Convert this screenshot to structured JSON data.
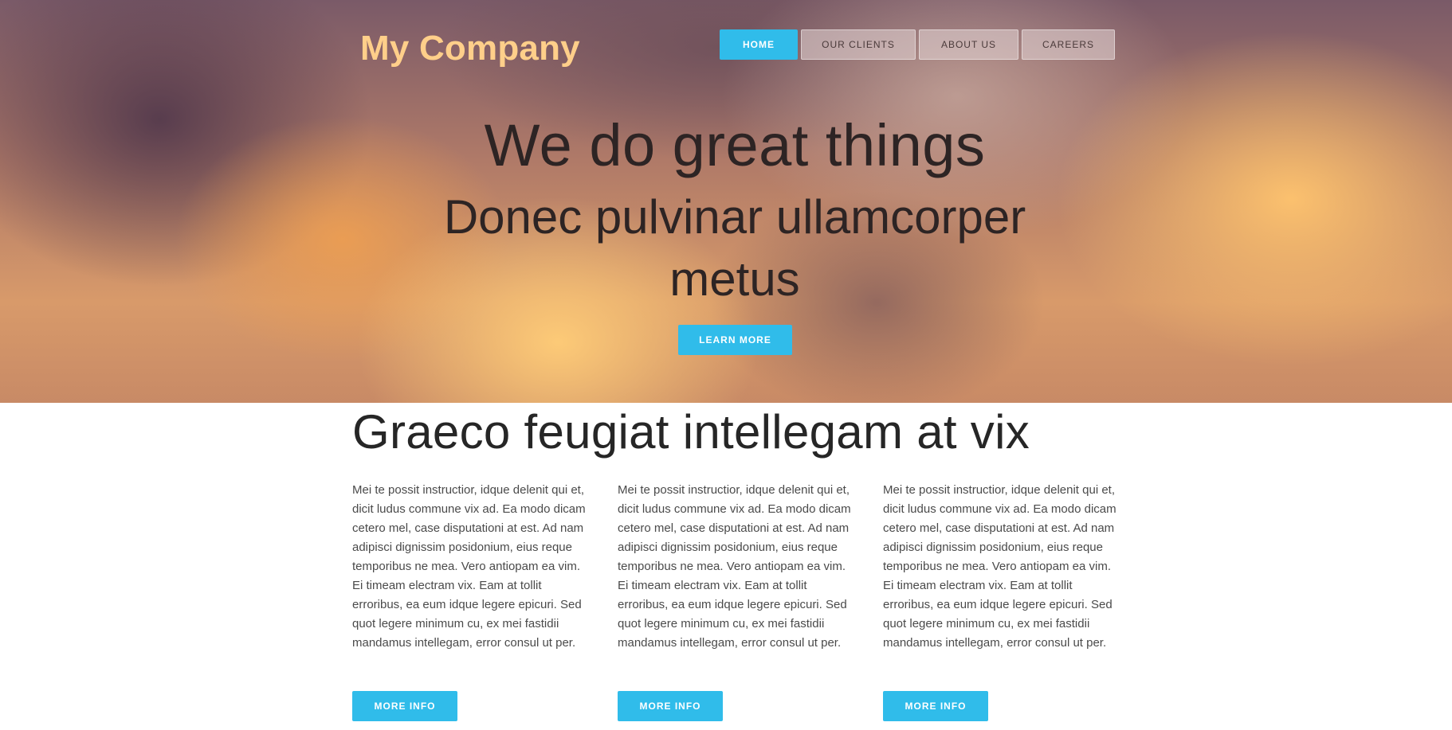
{
  "header": {
    "logo": "My Company",
    "nav": [
      {
        "label": "HOME",
        "active": true
      },
      {
        "label": "OUR CLIENTS",
        "active": false
      },
      {
        "label": "ABOUT US",
        "active": false
      },
      {
        "label": "CAREERS",
        "active": false
      }
    ]
  },
  "hero": {
    "title": "We do great things",
    "subtitle": "Donec pulvinar ullamcorper metus",
    "button_label": "LEARN MORE"
  },
  "section": {
    "title": "Graeco feugiat intellegam at vix",
    "columns": [
      {
        "text": "Mei te possit instructior, idque delenit qui et, dicit ludus commune vix ad. Ea modo dicam cetero mel, case disputationi at est. Ad nam adipisci dignissim posidonium, eius reque temporibus ne mea. Vero antiopam ea vim. Ei timeam electram vix. Eam at tollit erroribus, ea eum idque legere epicuri. Sed quot legere minimum cu, ex mei fastidii mandamus intellegam, error consul ut per.",
        "button_label": "MORE INFO"
      },
      {
        "text": "Mei te possit instructior, idque delenit qui et, dicit ludus commune vix ad. Ea modo dicam cetero mel, case disputationi at est. Ad nam adipisci dignissim posidonium, eius reque temporibus ne mea. Vero antiopam ea vim. Ei timeam electram vix. Eam at tollit erroribus, ea eum idque legere epicuri. Sed quot legere minimum cu, ex mei fastidii mandamus intellegam, error consul ut per.",
        "button_label": "MORE INFO"
      },
      {
        "text": "Mei te possit instructior, idque delenit qui et, dicit ludus commune vix ad. Ea modo dicam cetero mel, case disputationi at est. Ad nam adipisci dignissim posidonium, eius reque temporibus ne mea. Vero antiopam ea vim. Ei timeam electram vix. Eam at tollit erroribus, ea eum idque legere epicuri. Sed quot legere minimum cu, ex mei fastidii mandamus intellegam, error consul ut per.",
        "button_label": "MORE INFO"
      }
    ]
  },
  "colors": {
    "accent": "#30bcea",
    "logo": "#ffcf8a",
    "text_dark": "#2d2424"
  }
}
